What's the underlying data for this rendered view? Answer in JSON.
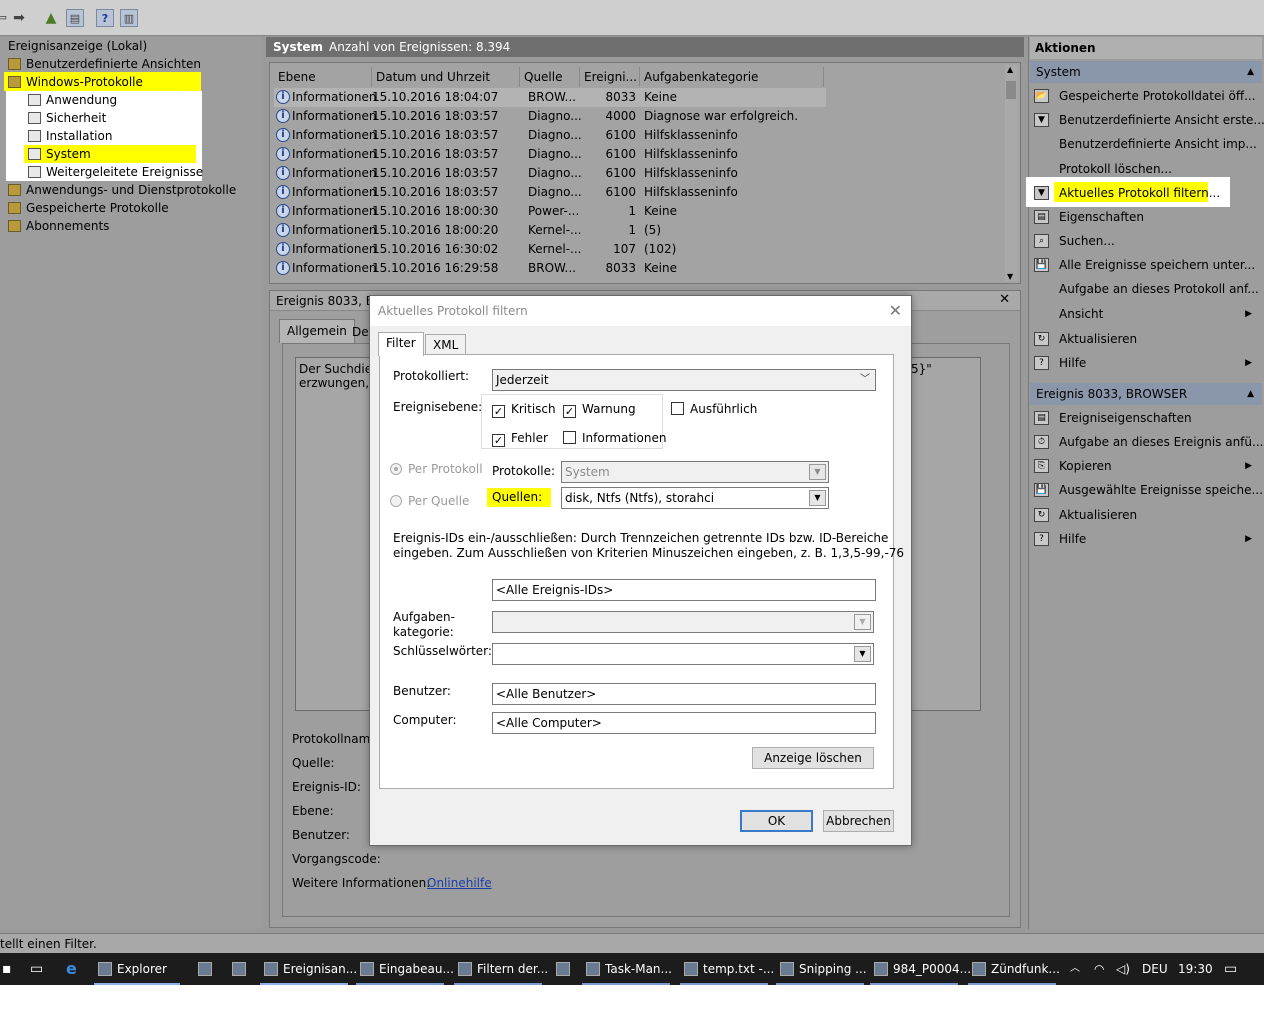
{
  "tree": {
    "items": [
      "Ereignisanzeige (Lokal)",
      "Benutzerdefinierte Ansichten",
      "Windows-Protokolle",
      "Anwendung",
      "Sicherheit",
      "Installation",
      "System",
      "Weitergeleitete Ereignisse",
      "Anwendungs- und Dienstprotokolle",
      "Gespeicherte Protokolle",
      "Abonnements"
    ]
  },
  "center": {
    "title": "System",
    "count_label": "Anzahl von Ereignissen: 8.394",
    "columns": [
      "Ebene",
      "Datum und Uhrzeit",
      "Quelle",
      "Ereigni...",
      "Aufgabenkategorie"
    ],
    "rows": [
      [
        "Informationen",
        "15.10.2016 18:04:07",
        "BROW...",
        "8033",
        "Keine"
      ],
      [
        "Informationen",
        "15.10.2016 18:03:57",
        "Diagno...",
        "4000",
        "Diagnose war erfolgreich."
      ],
      [
        "Informationen",
        "15.10.2016 18:03:57",
        "Diagno...",
        "6100",
        "Hilfsklasseninfo"
      ],
      [
        "Informationen",
        "15.10.2016 18:03:57",
        "Diagno...",
        "6100",
        "Hilfsklasseninfo"
      ],
      [
        "Informationen",
        "15.10.2016 18:03:57",
        "Diagno...",
        "6100",
        "Hilfsklasseninfo"
      ],
      [
        "Informationen",
        "15.10.2016 18:03:57",
        "Diagno...",
        "6100",
        "Hilfsklasseninfo"
      ],
      [
        "Informationen",
        "15.10.2016 18:00:30",
        "Power-...",
        "1",
        "Keine"
      ],
      [
        "Informationen",
        "15.10.2016 18:00:20",
        "Kernel-...",
        "1",
        "(5)"
      ],
      [
        "Informationen",
        "15.10.2016 16:30:02",
        "Kernel-...",
        "107",
        "(102)"
      ],
      [
        "Informationen",
        "15.10.2016 16:29:58",
        "BROW...",
        "8033",
        "Keine"
      ]
    ]
  },
  "detail": {
    "title": "Ereignis 8033, BRO",
    "close": "✕",
    "tab_general": "Allgemein",
    "tab_details": "Det",
    "desc_line1": "Der Suchdiens",
    "desc_line2": "erzwungen, da",
    "desc_tail": "5}\"",
    "labels": [
      "Protokollname",
      "Quelle:",
      "Ereignis-ID:",
      "Ebene:",
      "Benutzer:",
      "Vorgangscode:",
      "Weitere Informationen:"
    ],
    "link": "Onlinehilfe"
  },
  "actions": {
    "header": "Aktionen",
    "section1": "System",
    "items1": [
      "Gespeicherte Protokolldatei öff...",
      "Benutzerdefinierte Ansicht erste...",
      "Benutzerdefinierte Ansicht imp...",
      "Protokoll löschen...",
      "Aktuelles Protokoll filtern...",
      "Eigenschaften",
      "Suchen...",
      "Alle Ereignisse speichern unter...",
      "Aufgabe an dieses Protokoll anf...",
      "Ansicht",
      "Aktualisieren",
      "Hilfe"
    ],
    "section2": "Ereignis 8033, BROWSER",
    "items2": [
      "Ereigniseigenschaften",
      "Aufgabe an dieses Ereignis anfü...",
      "Kopieren",
      "Ausgewählte Ereignisse speiche...",
      "Aktualisieren",
      "Hilfe"
    ]
  },
  "dialog": {
    "title": "Aktuelles Protokoll filtern",
    "close": "✕",
    "tab_filter": "Filter",
    "tab_xml": "XML",
    "logged_label": "Protokolliert:",
    "logged_value": "Jederzeit",
    "level_label": "Ereignisebene:",
    "levels": {
      "critical": "Kritisch",
      "warning": "Warnung",
      "verbose": "Ausführlich",
      "error": "Fehler",
      "information": "Informationen"
    },
    "by_log": "Per Protokoll",
    "logs_label": "Protokolle:",
    "logs_value": "System",
    "by_source": "Per Quelle",
    "sources_label": "Quellen:",
    "sources_value": "disk, Ntfs (Ntfs), storahci",
    "ids_text1": "Ereignis-IDs ein-/ausschließen: Durch Trennzeichen getrennte IDs bzw. ID-Bereiche",
    "ids_text2": "eingeben. Zum Ausschließen von Kriterien Minuszeichen eingeben, z. B. 1,3,5-99,-76",
    "ids_value": "<Alle Ereignis-IDs>",
    "task_label1": "Aufgaben-",
    "task_label2": "kategorie:",
    "keywords_label": "Schlüsselwörter:",
    "user_label": "Benutzer:",
    "user_value": "<Alle Benutzer>",
    "computer_label": "Computer:",
    "computer_value": "<Alle Computer>",
    "clear_button": "Anzeige löschen",
    "ok_button": "OK",
    "cancel_button": "Abbrechen"
  },
  "status": "tellt einen Filter.",
  "taskbar": {
    "items": [
      "Explorer",
      "Ereignisan...",
      "Eingabeau...",
      "Filtern der...",
      "Task-Man...",
      "temp.txt -...",
      "Snipping ...",
      "984_P0004...",
      "Zündfunk..."
    ],
    "lang": "DEU",
    "time": "19:30"
  },
  "colors": {
    "highlight": "#ffff00",
    "link": "#1a3fa8",
    "default_button": "#3a78c8"
  }
}
